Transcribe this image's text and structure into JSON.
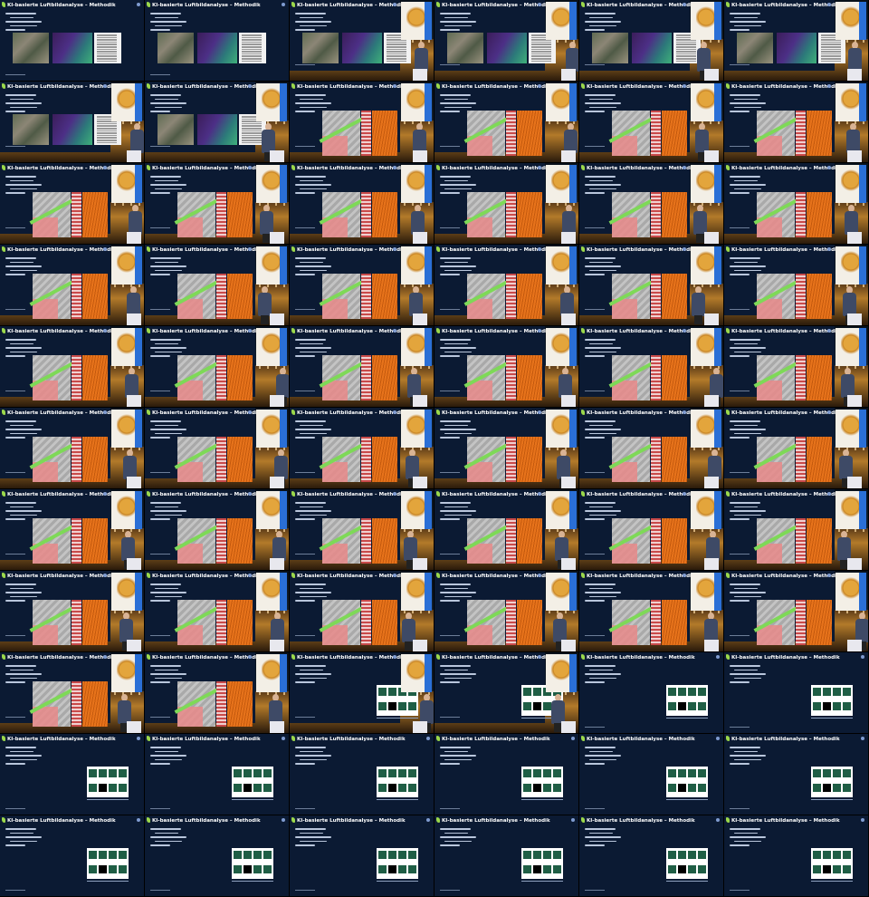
{
  "image": {
    "description_kind": "contact sheet of video frames from a lecture",
    "grid": {
      "columns": 6,
      "rows": 11
    },
    "slide_title": "KI-basierte Luftbildanalyse – Methodik",
    "accent_color": "#9bd84b",
    "slide_background": "#0b1a33",
    "row_kinds": [
      [
        "map",
        "map",
        "map-photo",
        "map-photo",
        "map-photo",
        "map-photo"
      ],
      [
        "map-photo",
        "map-photo",
        "anno-photo",
        "anno-photo",
        "anno-photo",
        "anno-photo"
      ],
      [
        "anno-photo",
        "anno-photo",
        "anno-photo",
        "anno-photo",
        "anno-photo",
        "anno-photo"
      ],
      [
        "anno-photo",
        "anno-photo",
        "anno-photo",
        "anno-photo",
        "anno-photo",
        "anno-photo"
      ],
      [
        "anno-photo",
        "anno-photo",
        "anno-photo",
        "anno-photo",
        "anno-photo",
        "anno-photo"
      ],
      [
        "anno-photo",
        "anno-photo",
        "anno-photo",
        "anno-photo",
        "anno-photo",
        "anno-photo"
      ],
      [
        "anno-photo",
        "anno-photo",
        "anno-photo",
        "anno-photo",
        "anno-photo",
        "anno-photo"
      ],
      [
        "anno-photo",
        "anno-photo",
        "anno-photo",
        "anno-photo",
        "anno-photo",
        "anno-photo"
      ],
      [
        "anno-photo",
        "anno-photo",
        "class-photo",
        "class-photo",
        "class",
        "class"
      ],
      [
        "class",
        "class",
        "class",
        "class",
        "class",
        "class"
      ],
      [
        "class",
        "class",
        "class",
        "class",
        "class",
        "class"
      ]
    ]
  }
}
